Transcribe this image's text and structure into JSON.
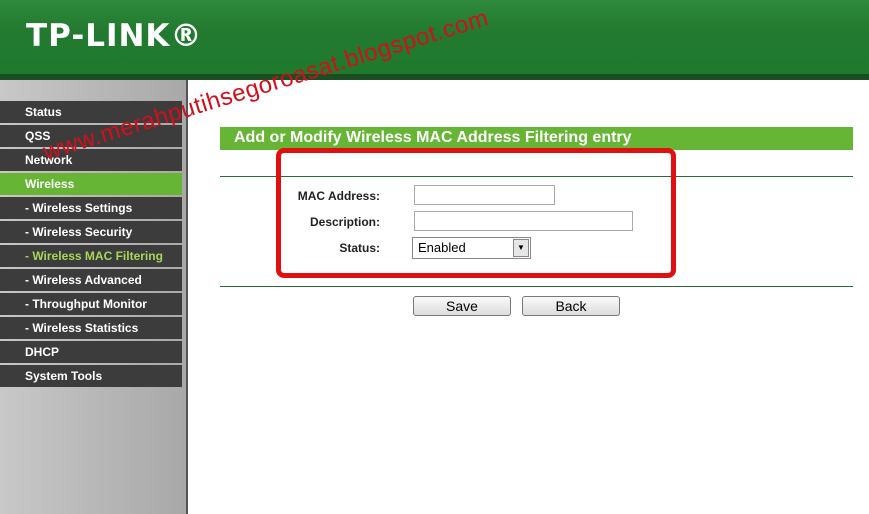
{
  "header": {
    "logo": "TP-LINK®"
  },
  "sidebar": {
    "items": [
      {
        "label": "Status"
      },
      {
        "label": "QSS"
      },
      {
        "label": "Network"
      },
      {
        "label": "Wireless",
        "active": true
      },
      {
        "label": "- Wireless Settings"
      },
      {
        "label": "- Wireless Security"
      },
      {
        "label": "- Wireless MAC Filtering",
        "current": true
      },
      {
        "label": "- Wireless Advanced"
      },
      {
        "label": "- Throughput Monitor"
      },
      {
        "label": "- Wireless Statistics"
      },
      {
        "label": "DHCP"
      },
      {
        "label": "System Tools"
      }
    ]
  },
  "main": {
    "title": "Add or Modify Wireless MAC Address Filtering entry",
    "mac_label": "MAC Address:",
    "mac_value": "",
    "desc_label": "Description:",
    "desc_value": "",
    "status_label": "Status:",
    "status_value": "Enabled",
    "save": "Save",
    "back": "Back"
  },
  "watermark": "www.merahputihsegoroasat.blogspot.com",
  "colors": {
    "brand_green": "#237a30",
    "accent_green": "#66b535",
    "highlight_red": "#e01010"
  }
}
